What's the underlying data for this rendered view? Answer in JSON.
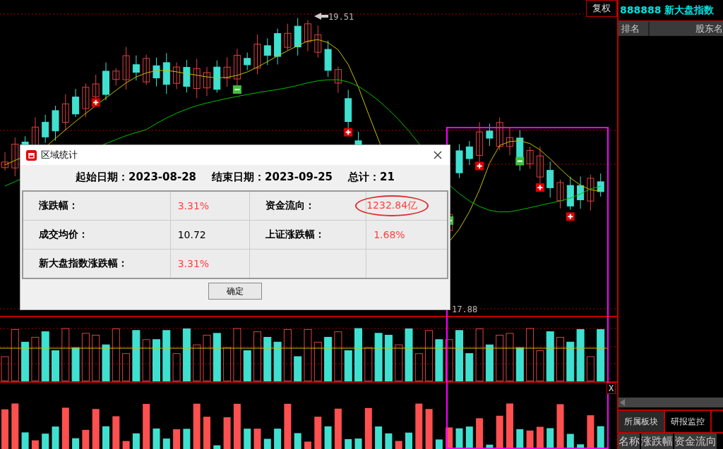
{
  "chart": {
    "adjust_button": "复权",
    "high_label": "19.51",
    "low_label": "17.88",
    "selection_close": "X"
  },
  "dialog": {
    "title": "区域统计",
    "summary": [
      "起始日期：2023-08-28",
      "结束日期：2023-09-25",
      "总计：21"
    ],
    "rows": [
      [
        {
          "label": "涨跌幅：",
          "value": "3.31%",
          "color": "#ff4040",
          "circled": false
        },
        {
          "label": "资金流向：",
          "value": "1232.84亿",
          "color": "#ff4040",
          "circled": true
        }
      ],
      [
        {
          "label": "成交均价：",
          "value": "10.72",
          "color": "#000000",
          "circled": false
        },
        {
          "label": "上证涨跌幅：",
          "value": "1.68%",
          "color": "#ff4040",
          "circled": false
        }
      ],
      [
        {
          "label": "新大盘指数涨跌幅：",
          "value": "3.31%",
          "color": "#ff4040",
          "circled": false
        }
      ]
    ],
    "ok_button": "确定"
  },
  "side_panel": {
    "title": "888888 新大盘指数",
    "columns": [
      "排名",
      "股东名"
    ],
    "tabs": [
      {
        "label": "所属板块",
        "selected": false
      },
      {
        "label": "研报监控",
        "selected": true
      }
    ],
    "list_columns": [
      "名称",
      "涨跌幅",
      "资金流向"
    ]
  }
}
